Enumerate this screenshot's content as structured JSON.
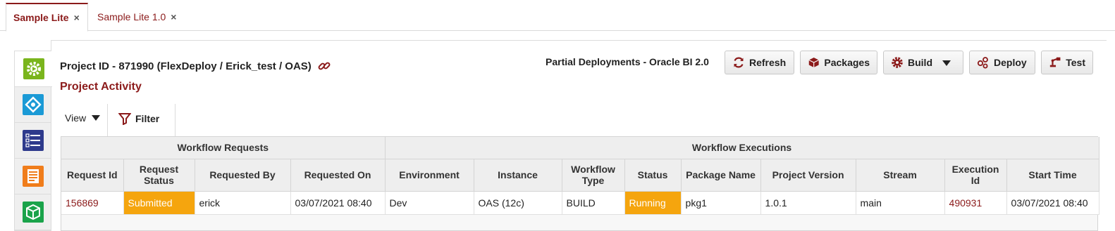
{
  "tabs": [
    {
      "label": "Sample Lite",
      "close": "×"
    },
    {
      "label": "Sample Lite 1.0",
      "close": "×"
    }
  ],
  "rail": [
    "project-config-icon",
    "workflow-icon",
    "list-icon",
    "document-icon",
    "package-icon"
  ],
  "header": {
    "project_id": "Project ID - 871990 (FlexDeploy / Erick_test / OAS)",
    "activity_title": "Project Activity",
    "partial": "Partial Deployments - Oracle BI 2.0"
  },
  "buttons": {
    "refresh": "Refresh",
    "packages": "Packages",
    "build": "Build",
    "deploy": "Deploy",
    "test": "Test"
  },
  "toolbar": {
    "view": "View",
    "filter": "Filter"
  },
  "table": {
    "group_headers": [
      "Workflow Requests",
      "Workflow Executions"
    ],
    "columns": [
      "Request Id",
      "Request Status",
      "Requested By",
      "Requested On",
      "Environment",
      "Instance",
      "Workflow Type",
      "Status",
      "Package Name",
      "Project Version",
      "Stream",
      "Execution Id",
      "Start Time"
    ],
    "rows": [
      [
        "156869",
        "Submitted",
        "erick",
        "03/07/2021 08:40",
        "Dev",
        "OAS (12c)",
        "BUILD",
        "Running",
        "pkg1",
        "1.0.1",
        "main",
        "490931",
        "03/07/2021 08:40"
      ]
    ]
  },
  "colors": {
    "accent": "#8b1a1a",
    "status_orange": "#f5a50e"
  }
}
